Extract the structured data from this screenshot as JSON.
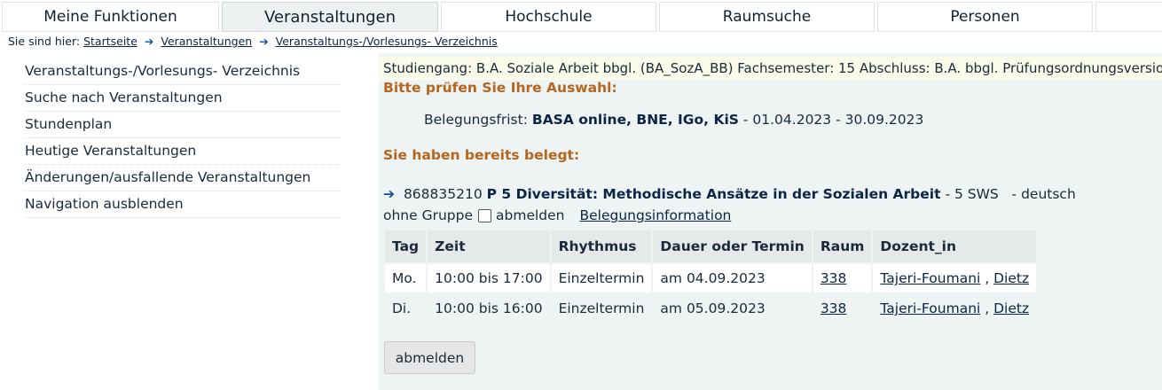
{
  "tabs": [
    "Meine Funktionen",
    "Veranstaltungen",
    "Hochschule",
    "Raumsuche",
    "Personen"
  ],
  "breadcrumb": {
    "prefix": "Sie sind hier:",
    "items": [
      "Startseite",
      "Veranstaltungen",
      "Veranstaltungs-/Vorlesungs- Verzeichnis"
    ]
  },
  "sidebar": {
    "items": [
      "Veranstaltungs-/Vorlesungs- Verzeichnis",
      "Suche nach Veranstaltungen",
      "Stundenplan",
      "Heutige Veranstaltungen",
      "Änderungen/ausfallende Veranstaltungen",
      "Navigation ausblenden"
    ]
  },
  "info": {
    "line": "Studiengang: B.A. Soziale Arbeit bbgl. (BA_SozA_BB) Fachsemester: 15 Abschluss: B.A. bbgl. Prüfungsordnungsversion"
  },
  "check_heading": "Bitte prüfen Sie Ihre Auswahl:",
  "frist": {
    "label": "Belegungsfrist:",
    "bold": "BASA online, BNE, IGo, KiS",
    "dates": "- 01.04.2023 - 30.09.2023"
  },
  "already_heading": "Sie haben bereits belegt:",
  "course": {
    "number": "868835210",
    "title": "P 5 Diversität: Methodische Ansätze in der Sozialen Arbeit",
    "sws": "- 5 SWS",
    "lang": "- deutsch"
  },
  "group": {
    "label": "ohne Gruppe",
    "checkbox_label": "abmelden",
    "info_link": "Belegungsinformation"
  },
  "table": {
    "headers": [
      "Tag",
      "Zeit",
      "Rhythmus",
      "Dauer oder Termin",
      "Raum",
      "Dozent_in"
    ],
    "rows": [
      {
        "tag": "Mo.",
        "zeit": "10:00 bis 17:00",
        "rhythmus": "Einzeltermin",
        "termin": "am 04.09.2023",
        "raum": "338",
        "doz1": "Tajeri-Foumani",
        "doz2": "Dietz"
      },
      {
        "tag": "Di.",
        "zeit": "10:00 bis 16:00",
        "rhythmus": "Einzeltermin",
        "termin": "am 05.09.2023",
        "raum": "338",
        "doz1": "Tajeri-Foumani",
        "doz2": "Dietz"
      }
    ]
  },
  "button_label": "abmelden"
}
